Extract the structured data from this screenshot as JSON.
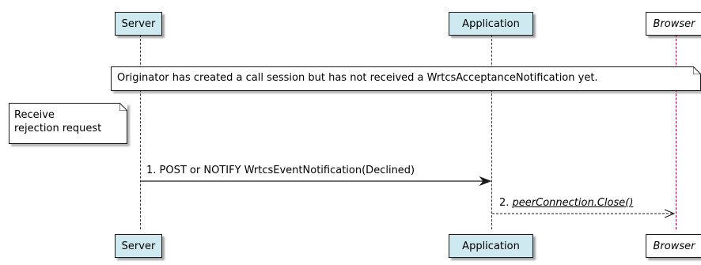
{
  "participants": [
    {
      "id": "server",
      "label": "Server",
      "style": "filled"
    },
    {
      "id": "application",
      "label": "Application",
      "style": "filled"
    },
    {
      "id": "browser",
      "label": "Browser",
      "style": "italic"
    }
  ],
  "notes": {
    "over_all": "Originator has created a call session but has not received a WrtcsAcceptanceNotification yet.",
    "left_line1": "Receive",
    "left_line2": "rejection request"
  },
  "messages": [
    {
      "label": "1. POST or NOTIFY WrtcsEventNotification(Declined)",
      "from": "Server",
      "to": "Application",
      "style": "solid"
    },
    {
      "number": "2.",
      "label": "peerConnection.Close()",
      "from": "Application",
      "to": "Browser",
      "style": "dashed"
    }
  ],
  "colors": {
    "participant_fill": "#cfe9f0",
    "lifeline": "#a80036",
    "border": "#1a1a1a"
  }
}
